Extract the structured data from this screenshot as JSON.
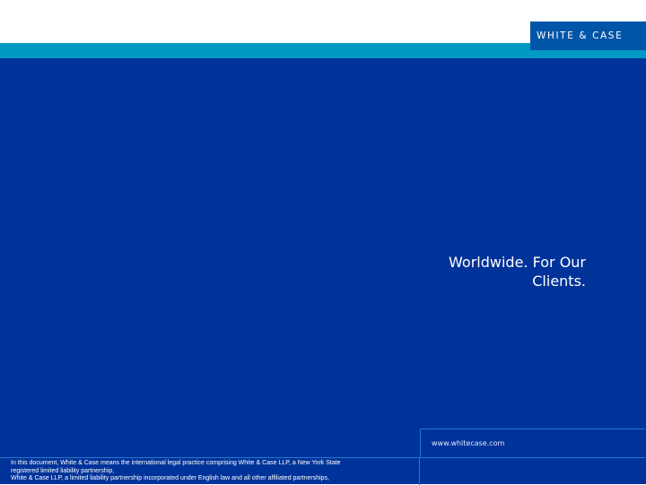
{
  "header": {
    "logo_text": "WHITE & CASE",
    "brand_colors": {
      "navy": "#003399",
      "teal": "#0099c4",
      "logo_blue": "#0055a8"
    }
  },
  "main": {
    "tagline_line1": "Worldwide. For Our",
    "tagline_line2": "Clients."
  },
  "footer": {
    "url": "www.whitecase.com",
    "disclaimer_line1": "In this document, White & Case means the international legal practice comprising White & Case LLP, a New York State",
    "disclaimer_line2": "registered limited liability partnership,",
    "disclaimer_line3": "White & Case LLP, a limited liability partnership incorporated under English law and all other affiliated partnerships,"
  }
}
